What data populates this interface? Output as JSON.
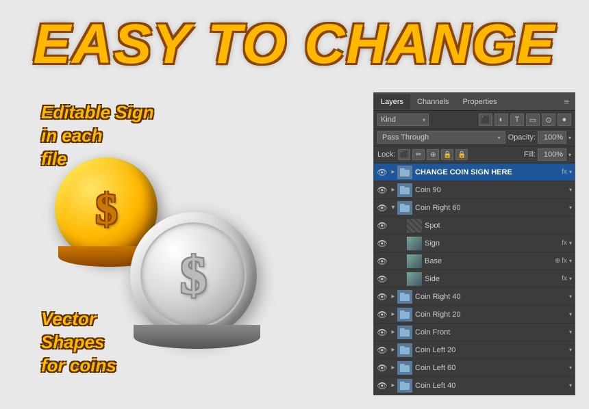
{
  "title": "EASY TO CHANGE",
  "subtitle_left_1": "Editable Sign\nin each\nfile",
  "subtitle_left_2": "Vector\nShapes\nfor coins",
  "panel": {
    "tabs": [
      "Layers",
      "Channels",
      "Properties"
    ],
    "active_tab": "Layers",
    "filter_label": "Kind",
    "blend_mode": "Pass Through",
    "opacity_label": "Opacity:",
    "opacity_value": "100%",
    "lock_label": "Lock:",
    "fill_label": "Fill:",
    "fill_value": "100%",
    "layers": [
      {
        "id": 1,
        "name": "CHANGE COIN SIGN HERE",
        "type": "group_top",
        "fx": true,
        "indent": 0,
        "visible": true,
        "expanded": false
      },
      {
        "id": 2,
        "name": "Coin 90",
        "type": "folder",
        "fx": false,
        "indent": 0,
        "visible": true,
        "expanded": false
      },
      {
        "id": 3,
        "name": "Coin Right 60",
        "type": "folder",
        "fx": false,
        "indent": 0,
        "visible": true,
        "expanded": true
      },
      {
        "id": 4,
        "name": "Spot",
        "type": "pattern",
        "fx": false,
        "indent": 1,
        "visible": true,
        "expanded": false
      },
      {
        "id": 5,
        "name": "Sign",
        "type": "smart",
        "fx": true,
        "indent": 1,
        "visible": true,
        "expanded": false
      },
      {
        "id": 6,
        "name": "Base",
        "type": "smart2",
        "fx": true,
        "indent": 1,
        "visible": true,
        "expanded": false,
        "link": true
      },
      {
        "id": 7,
        "name": "Side",
        "type": "smart",
        "fx": true,
        "indent": 1,
        "visible": true,
        "expanded": false
      },
      {
        "id": 8,
        "name": "Coin Right 40",
        "type": "folder",
        "fx": false,
        "indent": 0,
        "visible": true,
        "expanded": false
      },
      {
        "id": 9,
        "name": "Coin Right 20",
        "type": "folder",
        "fx": false,
        "indent": 0,
        "visible": true,
        "expanded": false
      },
      {
        "id": 10,
        "name": "Coin Front",
        "type": "folder",
        "fx": false,
        "indent": 0,
        "visible": true,
        "expanded": false
      },
      {
        "id": 11,
        "name": "Coin Left 20",
        "type": "folder",
        "fx": false,
        "indent": 0,
        "visible": true,
        "expanded": false
      },
      {
        "id": 12,
        "name": "Coin Left 60",
        "type": "folder",
        "fx": false,
        "indent": 0,
        "visible": true,
        "expanded": false
      },
      {
        "id": 13,
        "name": "Coin Left 40",
        "type": "folder",
        "fx": false,
        "indent": 0,
        "visible": true,
        "expanded": false
      }
    ]
  }
}
